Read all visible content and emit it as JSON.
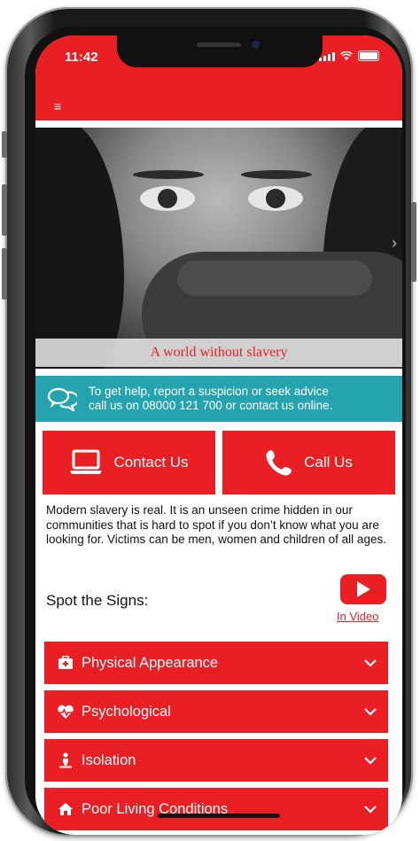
{
  "status": {
    "time": "11:42"
  },
  "header": {
    "menu_icon": "hamburger-icon"
  },
  "hero": {
    "caption": "A world without slavery",
    "slide_count": 8,
    "active_slide": 1
  },
  "info": {
    "icon": "chat-icon",
    "text_line1": "To get help, report a suspicion or seek advice",
    "text_line2": "call us on 08000 121 700 or contact us online."
  },
  "buttons": {
    "contact_label": "Contact Us",
    "contact_icon": "laptop-icon",
    "call_label": "Call Us",
    "call_icon": "phone-icon"
  },
  "intro": {
    "text": "Modern slavery is real. It is an unseen crime hidden in our communities that is hard to spot if you don’t know what you are looking for. Victims can be men, women and children of all ages."
  },
  "spot": {
    "title": "Spot the Signs:",
    "video_label": "In Video",
    "video_icon": "play-icon"
  },
  "sections": [
    {
      "label": "Physical Appearance",
      "icon": "first-aid-icon"
    },
    {
      "label": "Psychological",
      "icon": "heartbeat-icon"
    },
    {
      "label": "Isolation",
      "icon": "person-icon"
    },
    {
      "label": "Poor Living Conditions",
      "icon": "home-icon"
    }
  ],
  "colors": {
    "brand_red": "#e91f24",
    "teal": "#25a3ae"
  }
}
